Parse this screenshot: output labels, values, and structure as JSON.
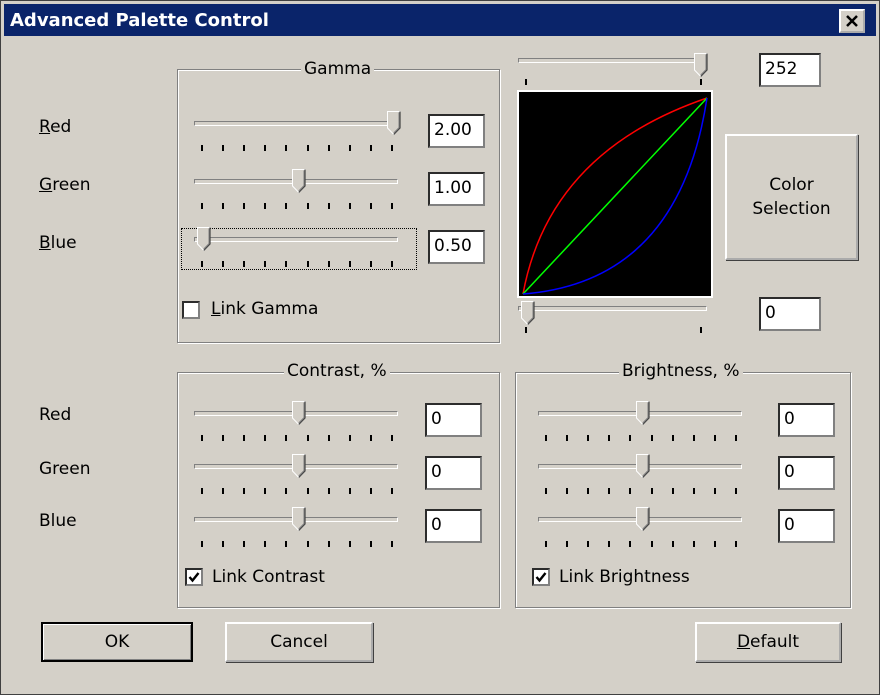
{
  "window": {
    "title": "Advanced Palette Control"
  },
  "gamma": {
    "group_title": "Gamma",
    "rows": [
      {
        "label_u": "R",
        "label_rest": "ed",
        "value": "2.00",
        "slider_fraction": 1.0
      },
      {
        "label_u": "G",
        "label_rest": "reen",
        "value": "1.00",
        "slider_fraction": 0.5
      },
      {
        "label_u": "B",
        "label_rest": "lue",
        "value": "0.50",
        "slider_fraction": 0.0
      }
    ],
    "link_label_u": "L",
    "link_label_rest": "ink Gamma",
    "link_checked": false
  },
  "curve": {
    "top_value": "252",
    "bottom_value": "0",
    "top_slider_fraction": 0.99,
    "bottom_slider_fraction": 0.0,
    "colors": {
      "red": "#ff0000",
      "green": "#00ff00",
      "blue": "#0000ff",
      "background": "#000000"
    }
  },
  "color_selection_button": {
    "line1": "Color",
    "line2": "Selection"
  },
  "contrast": {
    "group_title": "Contrast, %",
    "rows": [
      {
        "label": "Red",
        "value": "0",
        "slider_fraction": 0.5
      },
      {
        "label": "Green",
        "value": "0",
        "slider_fraction": 0.5
      },
      {
        "label": "Blue",
        "value": "0",
        "slider_fraction": 0.5
      }
    ],
    "link_label": "Link Contrast",
    "link_checked": true
  },
  "brightness": {
    "group_title": "Brightness, %",
    "rows": [
      {
        "value": "0",
        "slider_fraction": 0.5
      },
      {
        "value": "0",
        "slider_fraction": 0.5
      },
      {
        "value": "0",
        "slider_fraction": 0.5
      }
    ],
    "link_label": "Link Brightness",
    "link_checked": true
  },
  "buttons": {
    "ok": "OK",
    "cancel": "Cancel",
    "default_u": "D",
    "default_rest": "efault"
  }
}
